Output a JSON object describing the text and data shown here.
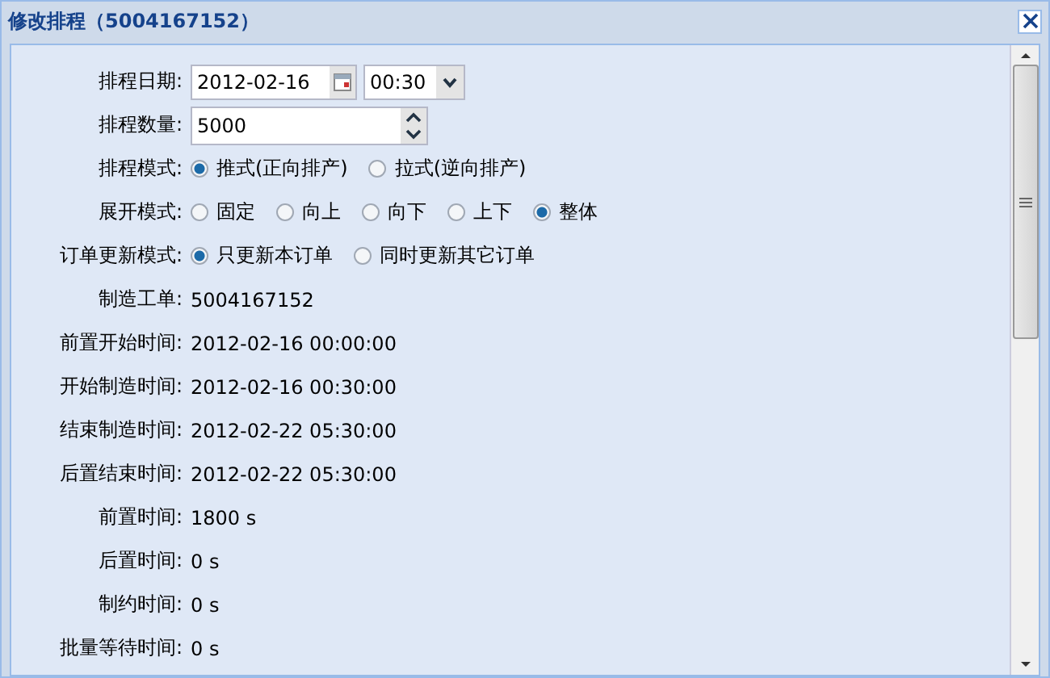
{
  "window": {
    "title": "修改排程（5004167152）"
  },
  "fields": [
    {
      "kind": "date_time",
      "label": "排程日期:",
      "date": "2012-02-16",
      "time": "00:30"
    },
    {
      "kind": "number",
      "label": "排程数量:",
      "value": "5000"
    },
    {
      "kind": "radio",
      "label": "排程模式:",
      "options": [
        {
          "label": "推式(正向排产)",
          "selected": true
        },
        {
          "label": "拉式(逆向排产)",
          "selected": false
        }
      ]
    },
    {
      "kind": "radio",
      "label": "展开模式:",
      "options": [
        {
          "label": "固定",
          "selected": false
        },
        {
          "label": "向上",
          "selected": false
        },
        {
          "label": "向下",
          "selected": false
        },
        {
          "label": "上下",
          "selected": false
        },
        {
          "label": "整体",
          "selected": true
        }
      ]
    },
    {
      "kind": "radio",
      "label": "订单更新模式:",
      "options": [
        {
          "label": "只更新本订单",
          "selected": true
        },
        {
          "label": "同时更新其它订单",
          "selected": false
        }
      ]
    },
    {
      "kind": "text",
      "label": "制造工单:",
      "value": "5004167152"
    },
    {
      "kind": "text",
      "label": "前置开始时间:",
      "value": "2012-02-16 00:00:00"
    },
    {
      "kind": "text",
      "label": "开始制造时间:",
      "value": "2012-02-16 00:30:00"
    },
    {
      "kind": "text",
      "label": "结束制造时间:",
      "value": "2012-02-22 05:30:00"
    },
    {
      "kind": "text",
      "label": "后置结束时间:",
      "value": "2012-02-22 05:30:00"
    },
    {
      "kind": "text",
      "label": "前置时间:",
      "value": "1800 s"
    },
    {
      "kind": "text",
      "label": "后置时间:",
      "value": "0 s"
    },
    {
      "kind": "text",
      "label": "制约时间:",
      "value": "0 s"
    },
    {
      "kind": "text",
      "label": "批量等待时间:",
      "value": "0 s"
    }
  ]
}
